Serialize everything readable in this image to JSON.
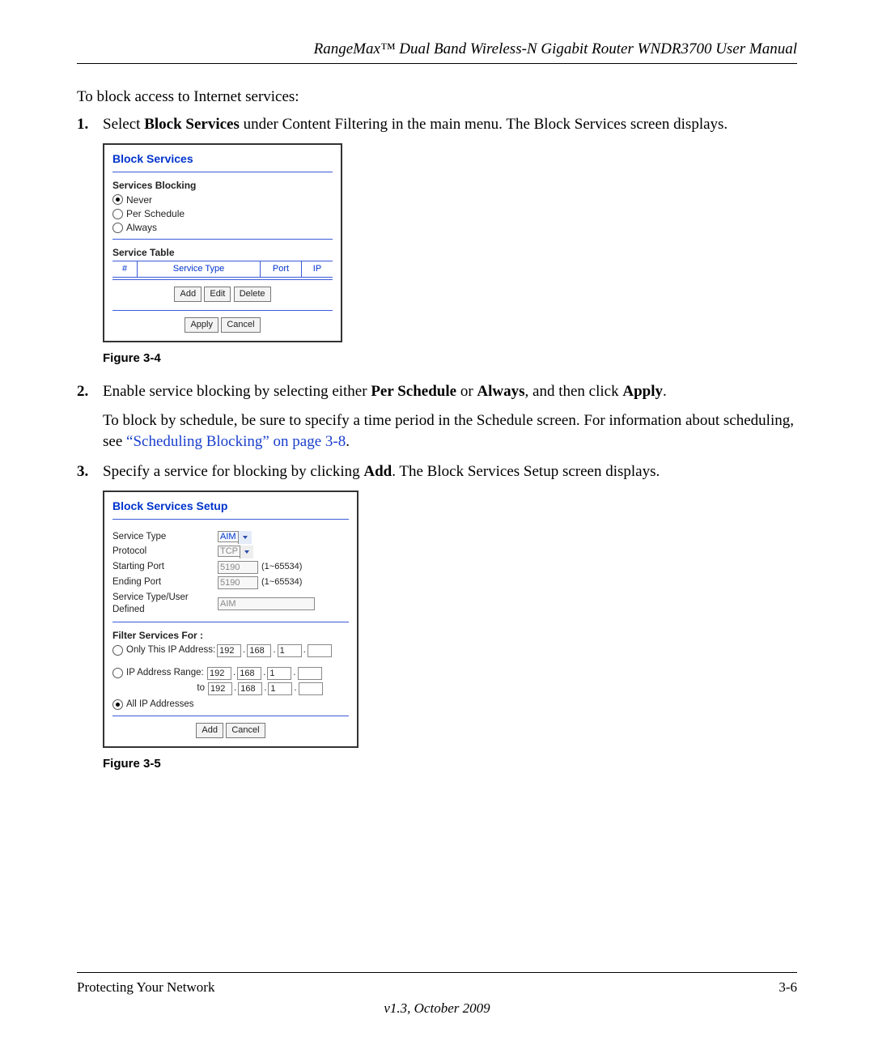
{
  "header": {
    "title": "RangeMax™ Dual Band Wireless-N Gigabit Router WNDR3700 User Manual"
  },
  "intro": "To block access to Internet services:",
  "steps": {
    "s1": {
      "pre": "Select ",
      "bold": "Block Services",
      "post": " under Content Filtering in the main menu. The Block Services screen displays."
    },
    "s2": {
      "line1_pre": "Enable service blocking by selecting either ",
      "line1_b1": "Per Schedule",
      "line1_mid": " or ",
      "line1_b2": "Always",
      "line1_mid2": ", and then click ",
      "line1_b3": "Apply",
      "line1_end": ".",
      "line2_pre": "To block by schedule, be sure to specify a time period in the Schedule screen. For information about scheduling, see ",
      "line2_link": "“Scheduling Blocking” on page 3-8",
      "line2_end": "."
    },
    "s3": {
      "pre": "Specify a service for blocking by clicking ",
      "bold": "Add",
      "post": ". The Block Services Setup screen displays."
    }
  },
  "fig34": {
    "caption": "Figure 3-4",
    "title": "Block Services",
    "blocking_heading": "Services Blocking",
    "radio_never": "Never",
    "radio_per_schedule": "Per Schedule",
    "radio_always": "Always",
    "table_heading": "Service Table",
    "th_num": "#",
    "th_type": "Service Type",
    "th_port": "Port",
    "th_ip": "IP",
    "btn_add": "Add",
    "btn_edit": "Edit",
    "btn_delete": "Delete",
    "btn_apply": "Apply",
    "btn_cancel": "Cancel"
  },
  "fig35": {
    "caption": "Figure 3-5",
    "title": "Block Services Setup",
    "lbl_service_type": "Service Type",
    "val_service_type": "AIM",
    "lbl_protocol": "Protocol",
    "val_protocol": "TCP",
    "lbl_start_port": "Starting Port",
    "val_start_port": "5190",
    "hint_start": "(1~65534)",
    "lbl_end_port": "Ending Port",
    "val_end_port": "5190",
    "hint_end": "(1~65534)",
    "lbl_user_defined": "Service Type/User Defined",
    "val_user_defined": "AIM",
    "filter_heading": "Filter Services For :",
    "radio_only_ip": "Only This IP Address:",
    "radio_ip_range": "IP Address Range:",
    "to_label": "to",
    "radio_all_ip": "All IP Addresses",
    "ip": {
      "a": "192",
      "b": "168",
      "c": "1",
      "d": ""
    },
    "btn_add": "Add",
    "btn_cancel": "Cancel"
  },
  "footer": {
    "section": "Protecting Your Network",
    "page": "3-6",
    "version": "v1.3, October 2009"
  }
}
